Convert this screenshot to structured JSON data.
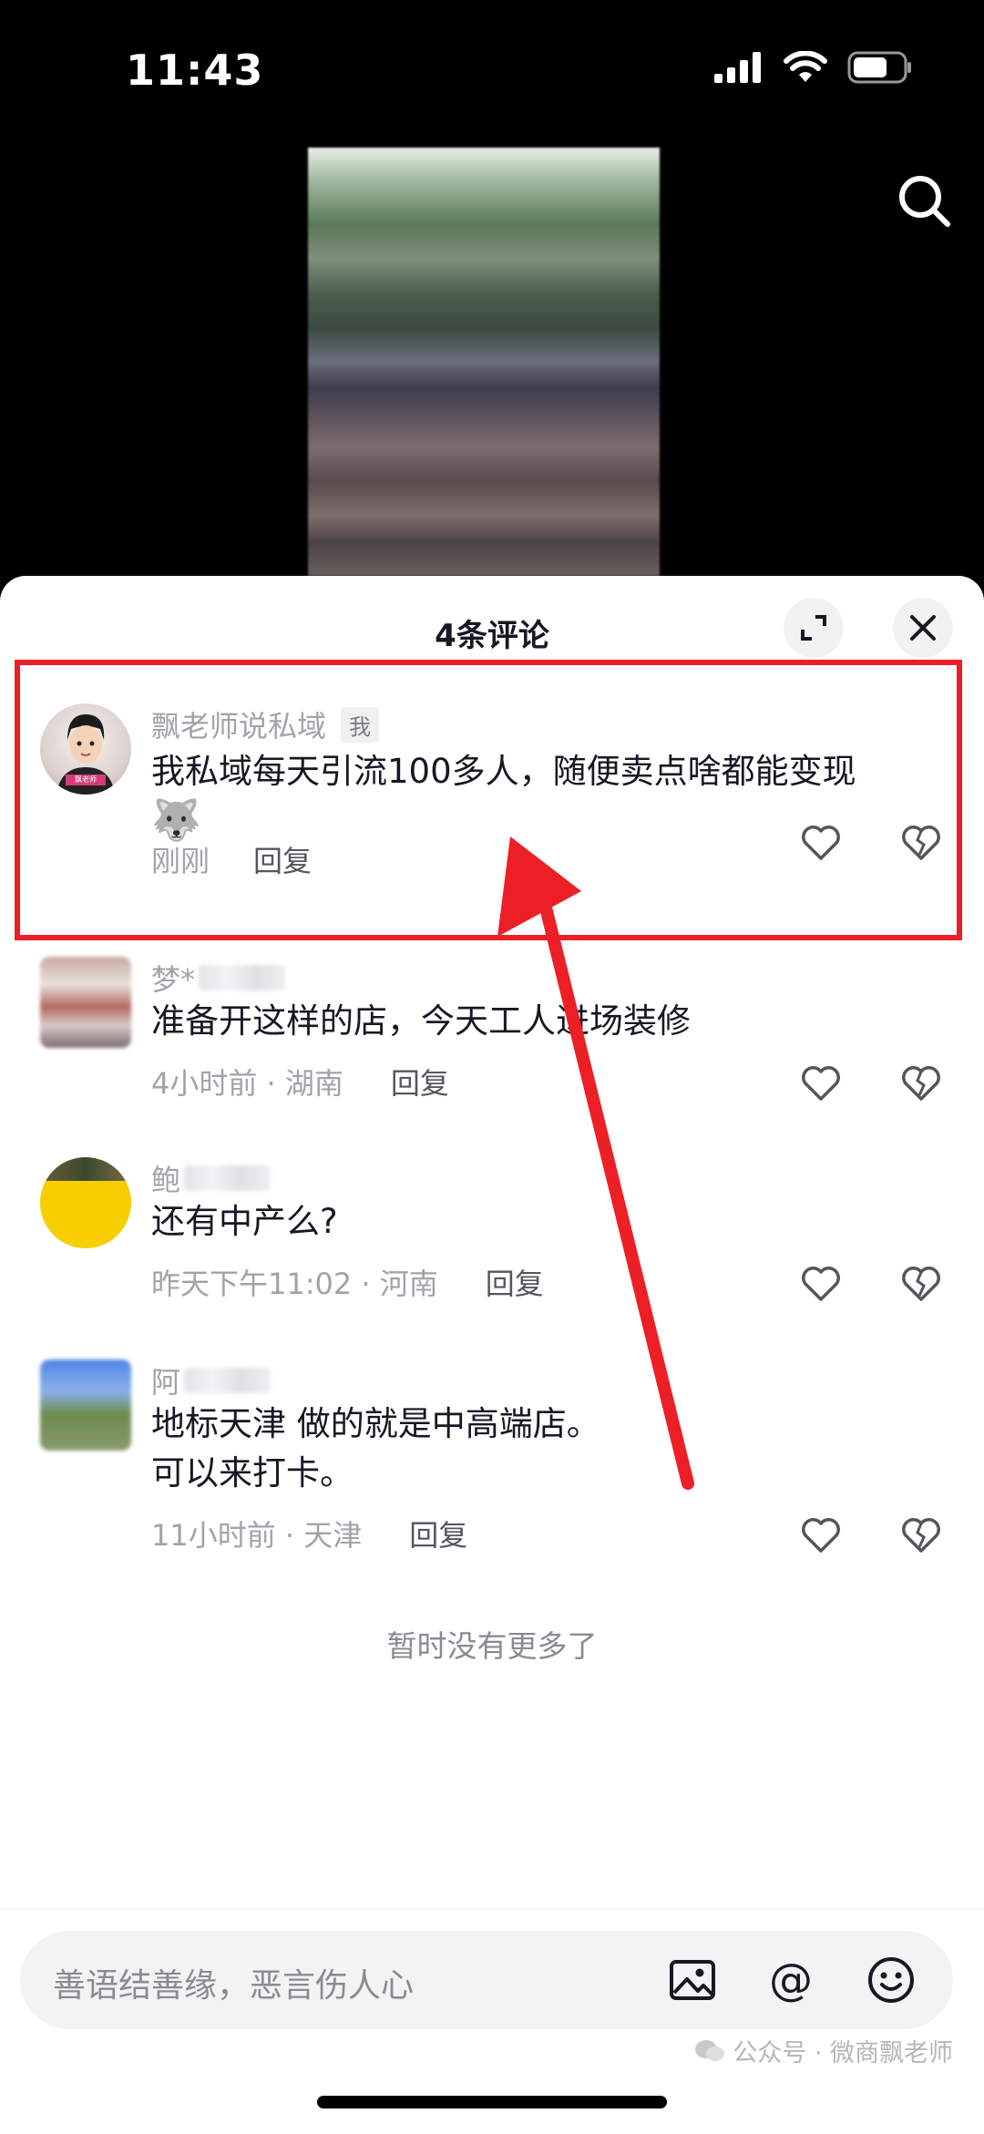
{
  "status": {
    "time": "11:43"
  },
  "sheet": {
    "title": "4条评论"
  },
  "comments": [
    {
      "user": "飘老师说私域",
      "badge": "我",
      "text": "我私域每天引流100多人，随便卖点啥都能变现",
      "emoji": "🐺",
      "time": "刚刚",
      "location": "",
      "reply": "回复",
      "avatar_caption": "飘老师"
    },
    {
      "user": "梦*",
      "text": "准备开这样的店，今天工人进场装修",
      "time": "4小时前 · 湖南",
      "reply": "回复"
    },
    {
      "user": "鲍",
      "text": "还有中产么?",
      "time": "昨天下午11:02 · 河南",
      "reply": "回复"
    },
    {
      "user": "阿",
      "text_line1": "地标天津 做的就是中高端店。",
      "text_line2": "可以来打卡。",
      "time": "11小时前 · 天津",
      "reply": "回复"
    }
  ],
  "no_more": "暂时没有更多了",
  "input": {
    "placeholder": "善语结善缘，恶言伤人心"
  },
  "watermark": "公众号 · 微商飘老师",
  "colors": {
    "highlight": "#ec1f26",
    "text": "#161823",
    "meta": "#a2a3a8"
  }
}
